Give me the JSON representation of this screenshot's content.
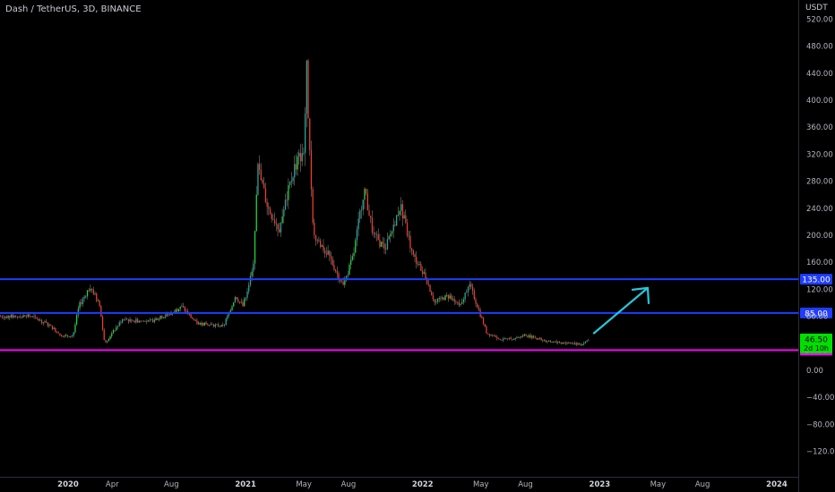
{
  "header": {
    "title": "Dash / TetherUS, 3D, BINANCE",
    "currency": "USDT"
  },
  "colors": {
    "up": "#26a69a",
    "up_bright": "#22d43a",
    "down": "#ef3b2c",
    "blue_line": "#1f3cff",
    "magenta_line": "#ff00ff",
    "arrow": "#26c6da",
    "price_tag_bg": "#00e000"
  },
  "chart_data": {
    "type": "candlestick",
    "ylim": [
      -130,
      520
    ],
    "y_ticks": [
      520,
      480,
      440,
      400,
      360,
      320,
      280,
      240,
      200,
      160,
      120,
      80,
      40,
      0,
      -40,
      -80,
      -120
    ],
    "y_tick_labels": [
      "520.00",
      "480.00",
      "440.00",
      "400.00",
      "360.00",
      "320.00",
      "280.00",
      "240.00",
      "200.00",
      "160.00",
      "120.00",
      "80.00",
      "40.00",
      "0.00",
      "−40.00",
      "−80.00",
      "−120.00"
    ],
    "x_ticks": [
      "2020",
      "Apr",
      "Aug",
      "2021",
      "May",
      "Aug",
      "2022",
      "May",
      "Aug",
      "2023",
      "May",
      "Aug",
      "2024"
    ],
    "x_tick_dates": [
      "2020-01-01",
      "2020-04-01",
      "2020-08-01",
      "2021-01-01",
      "2021-05-01",
      "2021-08-01",
      "2022-01-01",
      "2022-05-01",
      "2022-08-01",
      "2023-01-01",
      "2023-05-01",
      "2023-08-01",
      "2024-01-01"
    ],
    "price_path": [
      [
        "2019-10-15",
        80
      ],
      [
        "2019-11-20",
        68
      ],
      [
        "2019-12-20",
        50
      ],
      [
        "2020-01-10",
        52
      ],
      [
        "2020-01-22",
        95
      ],
      [
        "2020-02-15",
        125
      ],
      [
        "2020-03-05",
        95
      ],
      [
        "2020-03-15",
        40
      ],
      [
        "2020-04-20",
        75
      ],
      [
        "2020-06-15",
        72
      ],
      [
        "2020-08-01",
        85
      ],
      [
        "2020-08-20",
        95
      ],
      [
        "2020-09-20",
        70
      ],
      [
        "2020-11-15",
        65
      ],
      [
        "2020-12-10",
        110
      ],
      [
        "2020-12-25",
        95
      ],
      [
        "2021-01-15",
        150
      ],
      [
        "2021-01-25",
        300
      ],
      [
        "2021-02-15",
        240
      ],
      [
        "2021-03-10",
        210
      ],
      [
        "2021-04-10",
        300
      ],
      [
        "2021-05-01",
        330
      ],
      [
        "2021-05-05",
        460
      ],
      [
        "2021-05-12",
        320
      ],
      [
        "2021-05-20",
        200
      ],
      [
        "2021-06-20",
        170
      ],
      [
        "2021-07-20",
        125
      ],
      [
        "2021-08-10",
        170
      ],
      [
        "2021-09-01",
        270
      ],
      [
        "2021-09-20",
        200
      ],
      [
        "2021-10-15",
        180
      ],
      [
        "2021-11-01",
        215
      ],
      [
        "2021-11-15",
        245
      ],
      [
        "2021-12-10",
        170
      ],
      [
        "2022-01-05",
        140
      ],
      [
        "2022-01-25",
        100
      ],
      [
        "2022-02-20",
        110
      ],
      [
        "2022-03-20",
        95
      ],
      [
        "2022-04-05",
        130
      ],
      [
        "2022-04-25",
        90
      ],
      [
        "2022-05-12",
        55
      ],
      [
        "2022-06-15",
        45
      ],
      [
        "2022-08-01",
        52
      ],
      [
        "2022-09-20",
        42
      ],
      [
        "2022-11-10",
        40
      ],
      [
        "2022-11-20",
        38
      ],
      [
        "2022-12-10",
        46.5
      ]
    ],
    "horizontal_lines": [
      {
        "value": 135,
        "label": "135.00",
        "color": "#1f3cff"
      },
      {
        "value": 85,
        "label": "85.00",
        "color": "#1f3cff"
      },
      {
        "value": 30,
        "label": "30.00",
        "color": "#ff00ff"
      }
    ],
    "last_price": {
      "value": 46.5,
      "label": "46.50",
      "countdown": "2d 10h"
    },
    "annotation": {
      "type": "arrow",
      "from": [
        "2022-12-20",
        55
      ],
      "to": [
        "2023-04-10",
        122
      ]
    }
  }
}
